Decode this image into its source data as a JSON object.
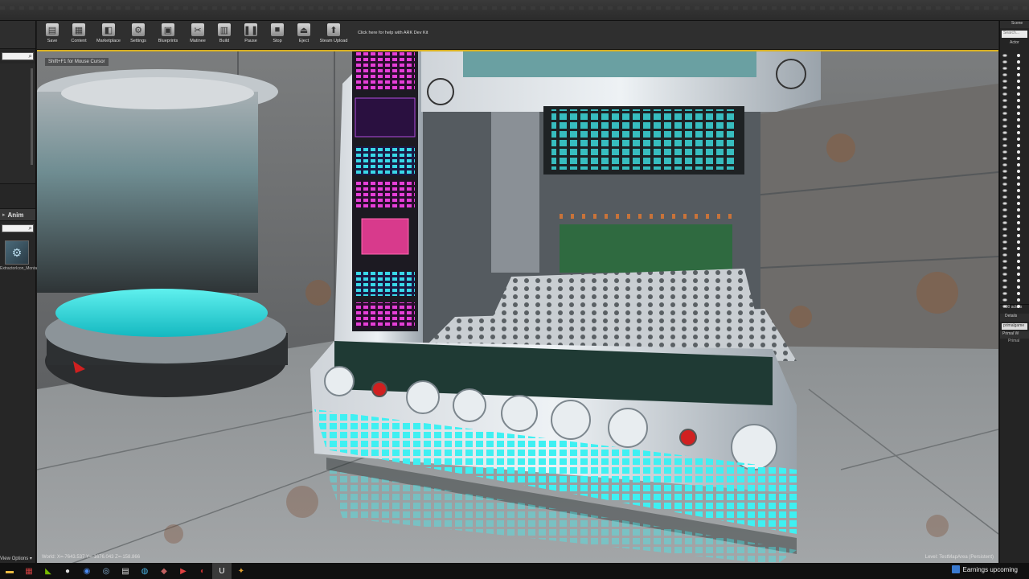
{
  "toolbar": {
    "buttons": [
      {
        "label": "Save",
        "icon": "save-icon",
        "glyph": "▤"
      },
      {
        "label": "Content",
        "icon": "content-icon",
        "glyph": "▦"
      },
      {
        "label": "Marketplace",
        "icon": "marketplace-icon",
        "glyph": "◧"
      },
      {
        "label": "Settings",
        "icon": "settings-icon",
        "glyph": "⚙"
      },
      {
        "label": "Blueprints",
        "icon": "blueprints-icon",
        "glyph": "▣"
      },
      {
        "label": "Matinee",
        "icon": "matinee-icon",
        "glyph": "✂"
      },
      {
        "label": "Build",
        "icon": "build-icon",
        "glyph": "▥"
      },
      {
        "label": "Pause",
        "icon": "pause-icon",
        "glyph": "❚❚"
      },
      {
        "label": "Stop",
        "icon": "stop-icon",
        "glyph": "■"
      },
      {
        "label": "Eject",
        "icon": "eject-icon",
        "glyph": "⏏"
      },
      {
        "label": "Steam Upload",
        "icon": "steam-upload-icon",
        "glyph": "⬆"
      }
    ],
    "help_text": "Click here for help with ARK Dev Kit"
  },
  "left_panel": {
    "anim_tab": "Anim",
    "asset_label": "ExtractorIcon_Montage",
    "view_options": "View Options ▾"
  },
  "viewport": {
    "hint": "Shift+F1 for Mouse Cursor",
    "coords": "World: X=-7643.537 Y=-1676.043 Z=-158.866",
    "level": "Level: TestMapArea (Persistent)"
  },
  "right_panel": {
    "tab": "Scene",
    "search_placeholder": "Search...",
    "column": "Actor",
    "actor_count": "180 actors",
    "details_tab": "Details",
    "details_field": "primalgame",
    "category": "Primal W",
    "subcategory": "Primal"
  },
  "taskbar": {
    "icons": [
      {
        "name": "file-explorer-icon",
        "glyph": "▬",
        "color": "#e8b840"
      },
      {
        "name": "calculator-icon",
        "glyph": "▦",
        "color": "#d04040"
      },
      {
        "name": "nvidia-icon",
        "glyph": "◣",
        "color": "#76b900"
      },
      {
        "name": "obs-icon",
        "glyph": "●",
        "color": "#dddddd"
      },
      {
        "name": "chrome-icon",
        "glyph": "◉",
        "color": "#4a8af0"
      },
      {
        "name": "steam-icon",
        "glyph": "◎",
        "color": "#8ab4d8"
      },
      {
        "name": "notepad-icon",
        "glyph": "▤",
        "color": "#dddddd"
      },
      {
        "name": "teamspeak-icon",
        "glyph": "◍",
        "color": "#4ab0e0"
      },
      {
        "name": "winrar-icon",
        "glyph": "◆",
        "color": "#c06060"
      },
      {
        "name": "media-player-icon",
        "glyph": "▶",
        "color": "#e04040"
      },
      {
        "name": "media-icon",
        "glyph": "◐",
        "color": "#c03030"
      },
      {
        "name": "unreal-editor-icon",
        "glyph": "U",
        "color": "#ffffff"
      },
      {
        "name": "ark-icon",
        "glyph": "✦",
        "color": "#e0a030"
      }
    ],
    "news": "Earnings upcoming"
  }
}
